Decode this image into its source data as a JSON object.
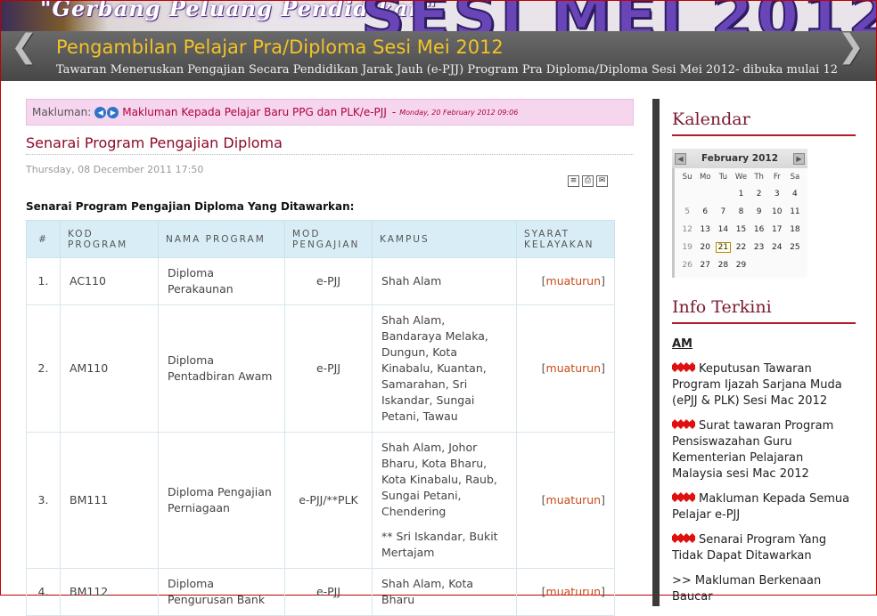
{
  "banner": {
    "tagline": "\"Gerbang Peluang Pendidikan\"",
    "big_text": "SESI MEI 2012",
    "slide_title": "Pengambilan Pelajar Pra/Diploma Sesi Mei 2012",
    "slide_subtitle": "Tawaran Meneruskan Pengajian Secara Pendidikan Jarak Jauh (e-PJJ) Program Pra Diploma/Diploma Sesi Mei 2012- dibuka mulai 12",
    "prev_glyph": "❮",
    "next_glyph": "❯"
  },
  "notice": {
    "label": "Makluman:",
    "link_text": "Makluman Kepada Pelajar Baru PPG dan PLK/e-PJJ",
    "separator": "-",
    "date": "Monday, 20 February 2012 09:06"
  },
  "article": {
    "title": "Senarai Program Pengajian Diploma",
    "date": "Thursday, 08 December 2011 17:50",
    "section_heading": "Senarai Program Pengajian Diploma Yang Ditawarkan:",
    "tools": [
      "pdf-icon",
      "print-icon",
      "email-icon"
    ]
  },
  "table": {
    "headers": {
      "no": "#",
      "kod": "KOD PROGRAM",
      "nama": "NAMA PROGRAM",
      "mod": "MOD PENGAJIAN",
      "kampus": "KAMPUS",
      "syarat": "SYARAT KELAYAKAN"
    },
    "download_label": "muaturun",
    "rows": [
      {
        "no": "1.",
        "kod": "AC110",
        "nama": "Diploma Perakaunan",
        "mod": "e-PJJ",
        "kampus": "Shah Alam",
        "note": ""
      },
      {
        "no": "2.",
        "kod": "AM110",
        "nama": "Diploma Pentadbiran Awam",
        "mod": "e-PJJ",
        "kampus": "Shah Alam, Bandaraya Melaka, Dungun, Kota Kinabalu, Kuantan, Samarahan, Sri Iskandar, Sungai Petani, Tawau",
        "note": ""
      },
      {
        "no": "3.",
        "kod": "BM111",
        "nama": "Diploma Pengajian Perniagaan",
        "mod": "e-PJJ/**PLK",
        "kampus": "Shah Alam, Johor Bharu, Kota Bharu, Kota Kinabalu, Raub, Sungai Petani, Chendering",
        "note": "** Sri Iskandar, Bukit Mertajam"
      },
      {
        "no": "4.",
        "kod": "BM112",
        "nama": "Diploma Pengurusan Bank",
        "mod": "e-PJJ",
        "kampus": "Shah Alam, Kota Bharu",
        "note": ""
      }
    ]
  },
  "sidebar": {
    "calendar_title": "Kalendar",
    "calendar": {
      "month_label": "February 2012",
      "day_names": [
        "Su",
        "Mo",
        "Tu",
        "We",
        "Th",
        "Fr",
        "Sa"
      ],
      "weeks": [
        [
          "",
          "",
          "",
          "1",
          "2",
          "3",
          "4"
        ],
        [
          "5",
          "6",
          "7",
          "8",
          "9",
          "10",
          "11"
        ],
        [
          "12",
          "13",
          "14",
          "15",
          "16",
          "17",
          "18"
        ],
        [
          "19",
          "20",
          "21",
          "22",
          "23",
          "24",
          "25"
        ],
        [
          "26",
          "27",
          "28",
          "29",
          "",
          "",
          ""
        ]
      ],
      "today": "21"
    },
    "info_title": "Info Terkini",
    "info_group": "AM",
    "info_items": [
      "Keputusan Tawaran Program Ijazah Sarjana Muda (ePJJ & PLK) Sesi Mac 2012",
      "Surat tawaran Program Pensiswazahan Guru Kementerian Pelajaran  Malaysia sesi Mac 2012",
      "Makluman Kepada Semua Pelajar e-PJJ",
      "Senarai Program Yang Tidak Dapat Ditawarkan"
    ],
    "info_more": ">> Makluman Berkenaan Baucar"
  }
}
